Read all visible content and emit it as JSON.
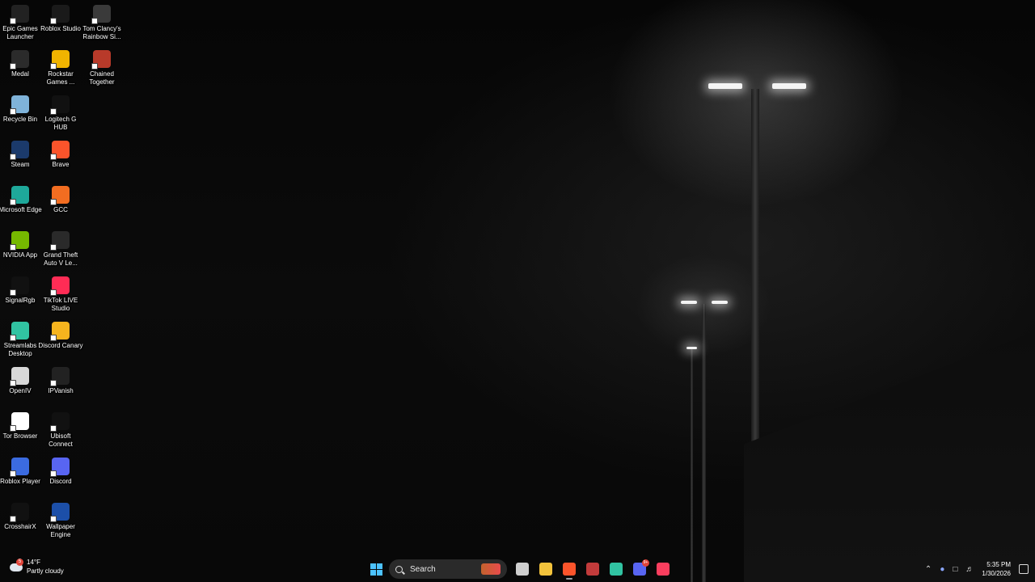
{
  "desktop": {
    "icons": [
      {
        "label": "Epic Games Launcher",
        "icon": "epic-games-icon",
        "color": "#222222"
      },
      {
        "label": "Roblox Studio",
        "icon": "roblox-studio-icon",
        "color": "#1a1a1a"
      },
      {
        "label": "Tom Clancy's Rainbow Si...",
        "icon": "rainbow-six-icon",
        "color": "#3a3a3a"
      },
      {
        "label": "Medal",
        "icon": "medal-icon",
        "color": "#2b2b2b"
      },
      {
        "label": "Rockstar Games ...",
        "icon": "rockstar-icon",
        "color": "#f0b400"
      },
      {
        "label": "Chained Together",
        "icon": "chained-together-icon",
        "color": "#b83a2a"
      },
      {
        "label": "Recycle Bin",
        "icon": "recycle-bin-icon",
        "color": "#7fb3d9"
      },
      {
        "label": "Logitech G HUB",
        "icon": "logitech-ghub-icon",
        "color": "#111111"
      },
      {
        "label": "Steam",
        "icon": "steam-icon",
        "color": "#1b3a6b"
      },
      {
        "label": "Brave",
        "icon": "brave-icon",
        "color": "#fb542b"
      },
      {
        "label": "Microsoft Edge",
        "icon": "edge-icon",
        "color": "#1ea89a"
      },
      {
        "label": "GCC",
        "icon": "gcc-icon",
        "color": "#f26d21"
      },
      {
        "label": "NVIDIA App",
        "icon": "nvidia-icon",
        "color": "#76b900"
      },
      {
        "label": "Grand Theft Auto V Le...",
        "icon": "gta-v-icon",
        "color": "#2a2a2a"
      },
      {
        "label": "SignalRgb",
        "icon": "signalrgb-icon",
        "color": "#111111"
      },
      {
        "label": "TikTok LIVE Studio",
        "icon": "tiktok-live-icon",
        "color": "#fe2c55"
      },
      {
        "label": "Streamlabs Desktop",
        "icon": "streamlabs-icon",
        "color": "#31c3a2"
      },
      {
        "label": "Discord Canary",
        "icon": "discord-canary-icon",
        "color": "#f5b41e"
      },
      {
        "label": "OpenIV",
        "icon": "openiv-icon",
        "color": "#d8d8d8"
      },
      {
        "label": "IPVanish",
        "icon": "ipvanish-icon",
        "color": "#222222"
      },
      {
        "label": "Tor Browser",
        "icon": "tor-browser-icon",
        "color": "#ffffff"
      },
      {
        "label": "Ubisoft Connect",
        "icon": "ubisoft-connect-icon",
        "color": "#111111"
      },
      {
        "label": "Roblox Player",
        "icon": "roblox-player-icon",
        "color": "#3b6be0"
      },
      {
        "label": "Discord",
        "icon": "discord-icon",
        "color": "#5865f2"
      },
      {
        "label": "CrosshairX",
        "icon": "crosshairx-icon",
        "color": "#111111"
      },
      {
        "label": "Wallpaper Engine",
        "icon": "wallpaper-engine-icon",
        "color": "#1c4fa8"
      }
    ]
  },
  "taskbar": {
    "weather": {
      "temp": "14°F",
      "condition": "Partly cloudy",
      "badge": "5"
    },
    "search_label": "Search",
    "apps": [
      {
        "name": "task-view-button",
        "icon": "task-view-icon",
        "color": "#cfcfcf"
      },
      {
        "name": "file-explorer-button",
        "icon": "folder-icon",
        "color": "#f3c33c"
      },
      {
        "name": "brave-taskbar-button",
        "icon": "brave-icon",
        "color": "#fb542b"
      },
      {
        "name": "app-taskbar-button",
        "icon": "red-app-icon",
        "color": "#c23b3b"
      },
      {
        "name": "streamlabs-taskbar-button",
        "icon": "streamlabs-icon",
        "color": "#31c3a2"
      },
      {
        "name": "discord-taskbar-button",
        "icon": "discord-icon",
        "color": "#5865f2"
      },
      {
        "name": "music-taskbar-button",
        "icon": "music-icon",
        "color": "#fa3e5e"
      }
    ],
    "discord_badge": "9+",
    "clock": {
      "time": "5:35 PM",
      "date": "1/30/2026"
    }
  },
  "colors": {
    "accent": "#4cc2ff"
  }
}
